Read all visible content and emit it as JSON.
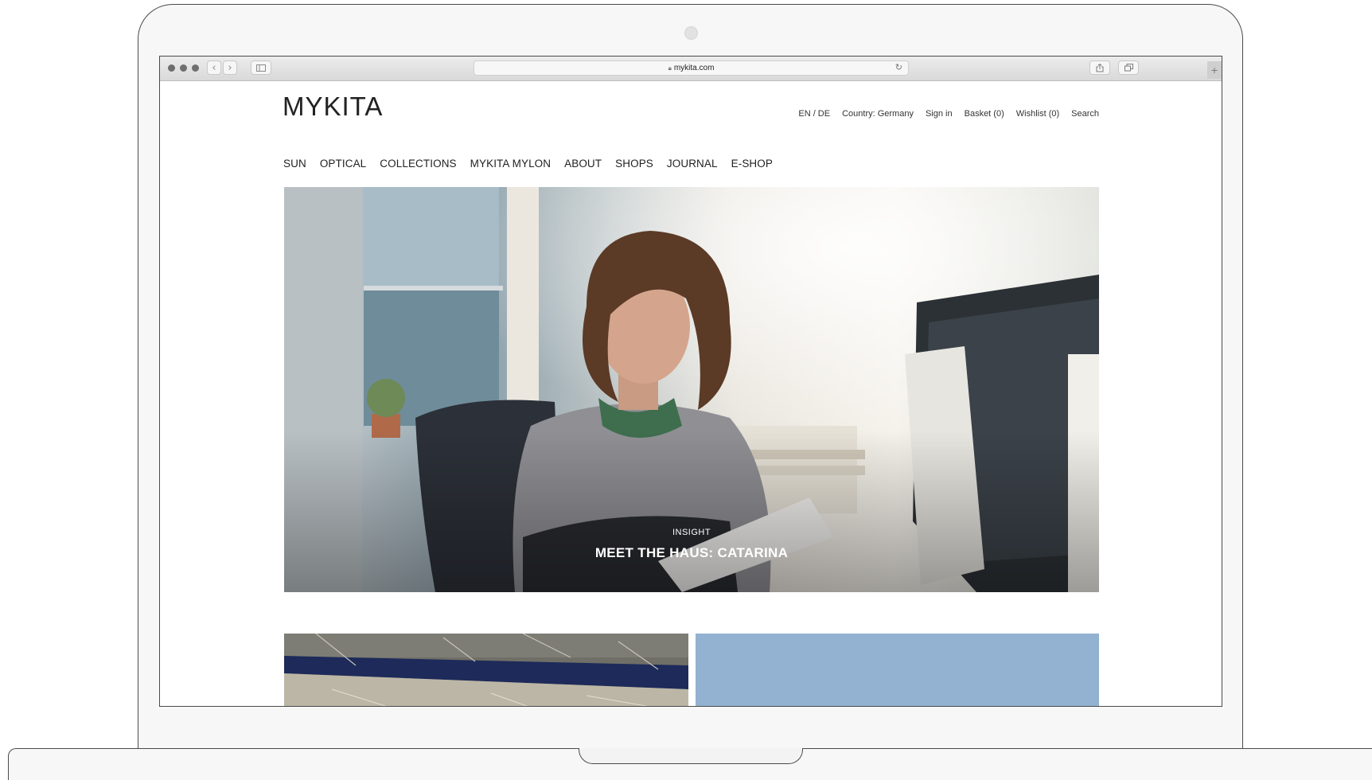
{
  "browser": {
    "url": "mykita.com",
    "back_icon": "chevron-left-icon",
    "forward_icon": "chevron-right-icon",
    "sidebar_icon": "sidebar-icon",
    "reload_icon": "reload-icon",
    "share_icon": "share-icon",
    "tabs_icon": "tabs-icon",
    "new_tab_icon": "plus-icon"
  },
  "site": {
    "logo": "MYKITA",
    "utility": {
      "language": "EN / DE",
      "country": "Country: Germany",
      "sign_in": "Sign in",
      "basket": "Basket (0)",
      "wishlist": "Wishlist (0)",
      "search": "Search"
    },
    "nav": [
      "SUN",
      "OPTICAL",
      "COLLECTIONS",
      "MYKITA MYLON",
      "ABOUT",
      "SHOPS",
      "JOURNAL",
      "E-SHOP"
    ]
  },
  "hero": {
    "kicker": "INSIGHT",
    "title": "MEET THE HAUS: CATARINA"
  },
  "colors": {
    "text": "#222222",
    "tile_blue": "#93b2d2",
    "hero_overlay_text": "#ffffff"
  }
}
